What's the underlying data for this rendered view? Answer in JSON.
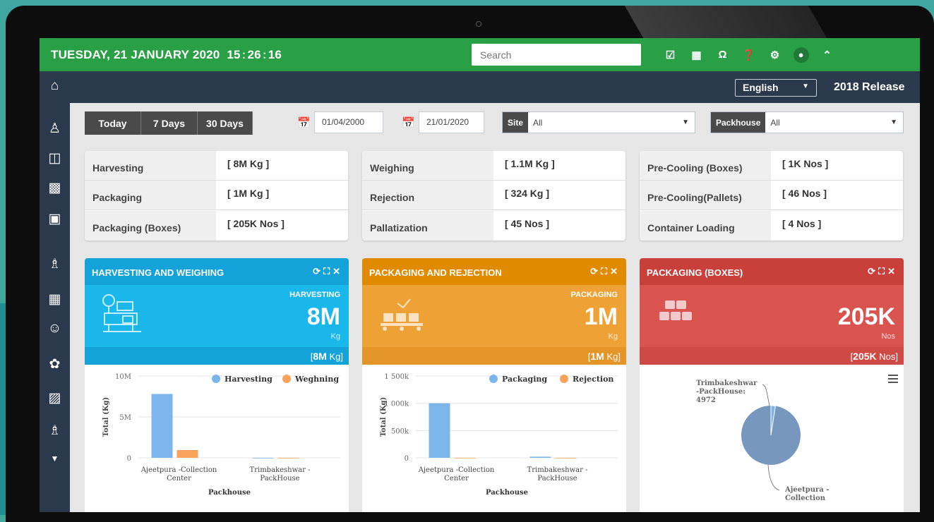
{
  "header": {
    "date": "TUESDAY, 21 JANUARY 2020",
    "hh": "15",
    "mm": "26",
    "ss": "16",
    "search_placeholder": "Search"
  },
  "top_icons": [
    "check-square-icon",
    "grid-icon",
    "headset-icon",
    "help-icon",
    "settings-icon",
    "user-icon",
    "chevron-up-icon"
  ],
  "nav": {
    "language": "English",
    "release": "2018 Release"
  },
  "sidebar": [
    "home-icon",
    "users-icon",
    "building-icon",
    "factory-icon",
    "monitor-icon",
    "box-hand-icon",
    "warehouse-icon",
    "team-icon",
    "plant-icon",
    "industry-icon",
    "package-icon",
    "chevron-down-icon"
  ],
  "filters": {
    "ranges": [
      "Today",
      "7 Days",
      "30 Days"
    ],
    "from_date": "01/04/2000",
    "to_date": "21/01/2020",
    "site_label": "Site",
    "site_value": "All",
    "packhouse_label": "Packhouse",
    "packhouse_value": "All"
  },
  "stats": [
    [
      {
        "name": "Harvesting",
        "value": "[ 8M Kg ]"
      },
      {
        "name": "Packaging",
        "value": "[ 1M Kg ]"
      },
      {
        "name": "Packaging (Boxes)",
        "value": "[ 205K Nos ]"
      }
    ],
    [
      {
        "name": "Weighing",
        "value": "[ 1.1M Kg ]"
      },
      {
        "name": "Rejection",
        "value": "[ 324 Kg ]"
      },
      {
        "name": "Pallatization",
        "value": "[ 45 Nos ]"
      }
    ],
    [
      {
        "name": "Pre-Cooling (Boxes)",
        "value": "[ 1K Nos ]"
      },
      {
        "name": "Pre-Cooling(Pallets)",
        "value": "[ 46 Nos ]"
      },
      {
        "name": "Container Loading",
        "value": "[ 4 Nos ]"
      }
    ]
  ],
  "panels": [
    {
      "title": "HARVESTING AND WEIGHING",
      "kpi_label": "HARVESTING",
      "kpi_value": "8M",
      "kpi_unit": "Kg",
      "total_open": "[",
      "total_value": "8M",
      "total_unit": "Kg",
      "total_close": "]",
      "colors": {
        "head": "#14a3d8",
        "kpi": "#1ab7ea",
        "total": "#14a3d8"
      }
    },
    {
      "title": "PACKAGING AND REJECTION",
      "kpi_label": "PACKAGING",
      "kpi_value": "1M",
      "kpi_unit": "Kg",
      "total_open": "[",
      "total_value": "1M",
      "total_unit": "Kg",
      "total_close": "]",
      "colors": {
        "head": "#e08a00",
        "kpi": "#eea236",
        "total": "#e39527"
      }
    },
    {
      "title": "PACKAGING (BOXES)",
      "kpi_label": "",
      "kpi_value": "205K",
      "kpi_unit": "Nos",
      "total_open": "[",
      "total_value": "205K",
      "total_unit": "Nos",
      "total_close": "]",
      "colors": {
        "head": "#c9403b",
        "kpi": "#d9534f",
        "total": "#cf4a45"
      }
    }
  ],
  "chart_data": [
    {
      "type": "bar",
      "categories": [
        "Ajeetpura -Collection Center",
        "Trimbakeshwar - PackHouse"
      ],
      "series": [
        {
          "name": "Harvesting",
          "values": [
            7800000,
            0
          ],
          "color": "#7cb5ec"
        },
        {
          "name": "Weghning",
          "values": [
            950000,
            0
          ],
          "color": "#f7a35c"
        }
      ],
      "xlabel": "Packhouse",
      "ylabel": "Total (Kg)",
      "yticks": [
        "0",
        "5M",
        "10M"
      ],
      "ylim": [
        0,
        10000000
      ],
      "legend": "top-right"
    },
    {
      "type": "bar",
      "categories": [
        "Ajeetpura -Collection Center",
        "Trimbakeshwar - PackHouse"
      ],
      "series": [
        {
          "name": "Packaging",
          "values": [
            1000000,
            20000
          ],
          "color": "#7cb5ec"
        },
        {
          "name": "Rejection",
          "values": [
            300,
            0
          ],
          "color": "#f7a35c"
        }
      ],
      "xlabel": "Packhouse",
      "ylabel": "Total (Kg)",
      "yticks": [
        "0",
        "500k",
        "1 000k",
        "1 500k"
      ],
      "ylim": [
        0,
        1500000
      ],
      "legend": "top-right"
    },
    {
      "type": "pie",
      "slices": [
        {
          "label": "Trimbakeshwar -PackHouse:",
          "value_text": "4972",
          "value": 4972
        },
        {
          "label": "Ajeetpura - Collection",
          "value_text": "",
          "value": 200000
        }
      ],
      "color": "#7797bf",
      "menu_icon": "hamburger-icon"
    }
  ]
}
